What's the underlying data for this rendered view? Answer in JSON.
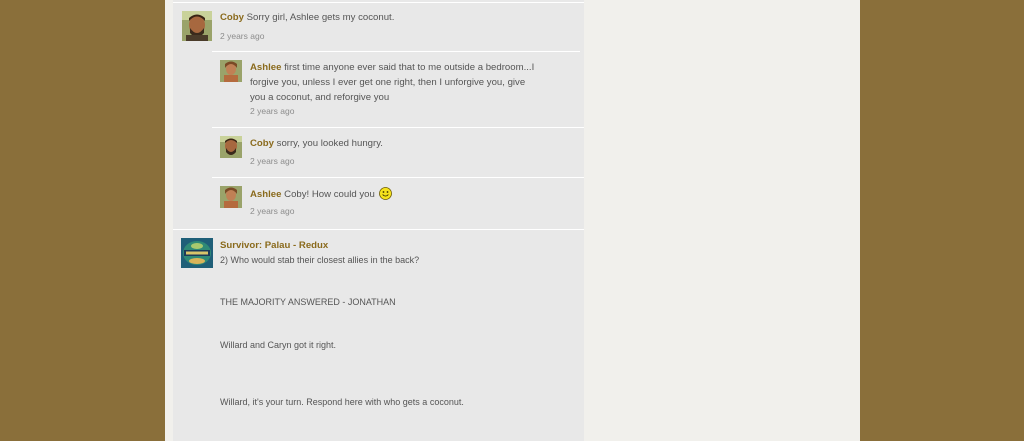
{
  "comments": [
    {
      "author": "Coby",
      "text": "Sorry girl, Ashlee gets my coconut.",
      "time": "2 years ago",
      "avatar_icon": "coby-avatar-icon"
    },
    {
      "author": "Ashlee",
      "text": "first time anyone ever said that to me outside a bedroom...I forgive you, unless I ever get one right, then I unforgive you, give you a coconut, and reforgive you",
      "time": "2 years ago",
      "avatar_icon": "ashlee-avatar-icon"
    },
    {
      "author": "Coby",
      "text": "sorry, you looked hungry.",
      "time": "2 years ago",
      "avatar_icon": "coby-avatar-icon"
    },
    {
      "author": "Ashlee",
      "text": "Coby!  How could you",
      "time": "2 years ago",
      "avatar_icon": "ashlee-avatar-icon",
      "emoticon": "smiley-icon"
    }
  ],
  "post": {
    "author": "Survivor: Palau - Redux",
    "avatar_icon": "survivor-palau-logo",
    "lines": [
      "2)  Who would stab their closest allies in the back?",
      "THE MAJORITY ANSWERED  -  JONATHAN",
      "Willard and Caryn got it right.",
      "Willard, it's your turn.  Respond here with who gets a coconut."
    ]
  },
  "colors": {
    "outer_background": "#8a6f3a",
    "page_background": "#f1f0ec",
    "feed_background": "#e8e8e8",
    "author_link": "#8a6a1c"
  }
}
